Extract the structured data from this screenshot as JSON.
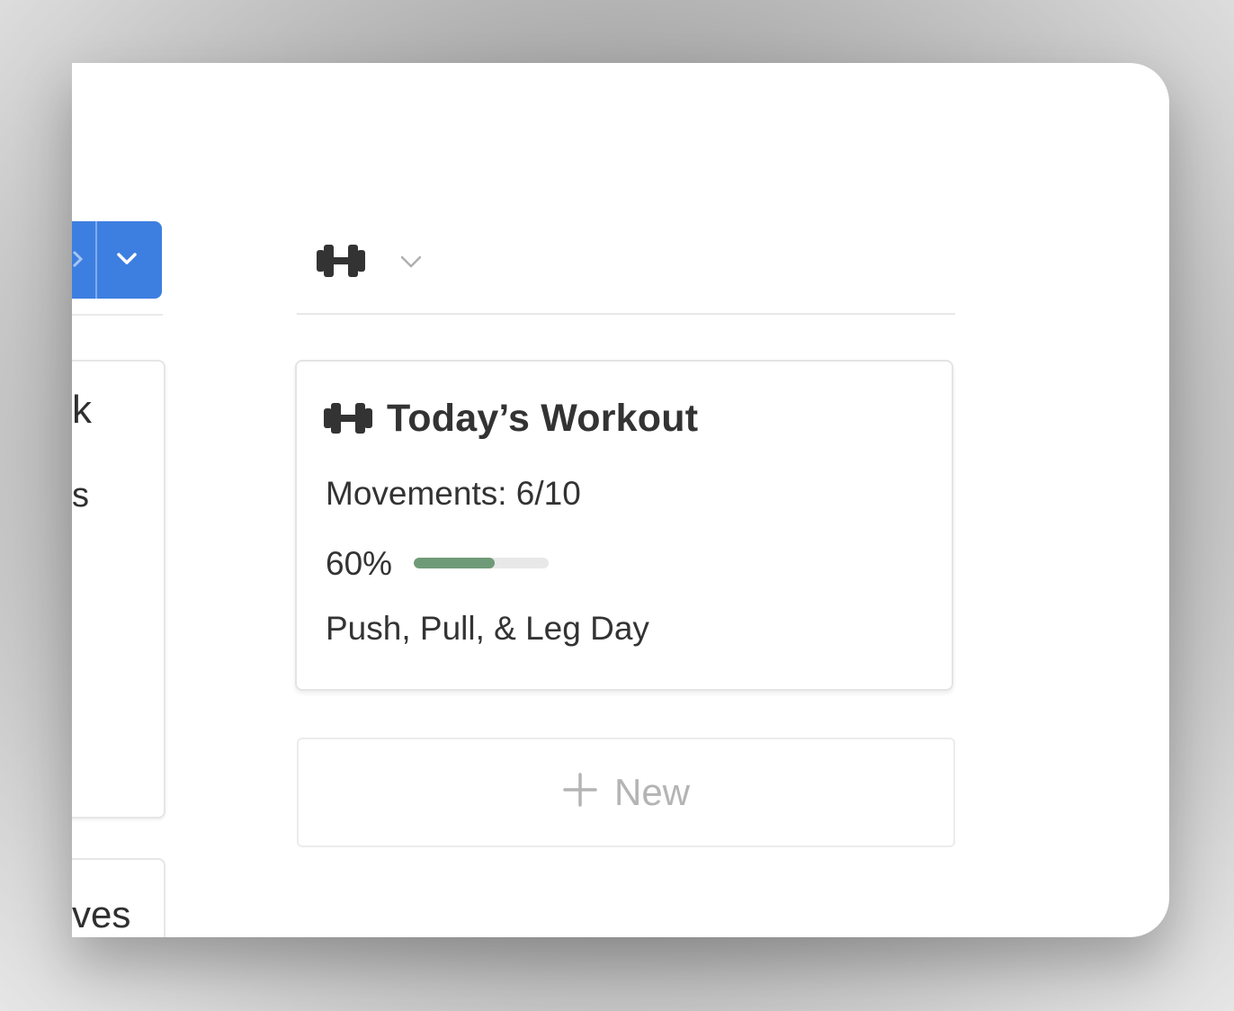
{
  "left_column": {
    "card_title_fragment": "k",
    "card_line_fragment": "s",
    "bottom_card_fragment": "ves",
    "button_color": "#3d7fe0"
  },
  "board_column": {
    "header_icon": "dumbbell-icon",
    "header_chevron": "chevron-down-icon"
  },
  "card": {
    "icon": "dumbbell-icon",
    "title": "Today’s Workout",
    "movements": "Movements: 6/10",
    "progress_label": "60%",
    "progress_value": 0.6,
    "progress_color": "#6f9a77",
    "tags": "Push, Pull, & Leg Day"
  },
  "new_button": {
    "icon": "plus-icon",
    "label": "New"
  }
}
